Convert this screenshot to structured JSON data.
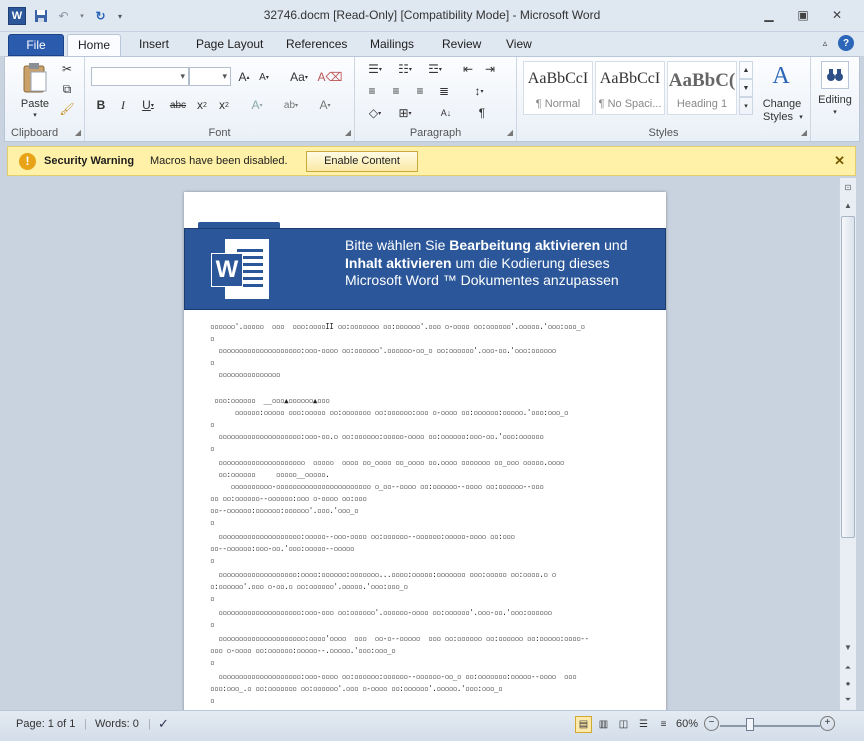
{
  "window": {
    "title": "32746.docm [Read-Only] [Compatibility Mode]  -  Microsoft Word",
    "app_icon": "W"
  },
  "ribbon_tabs": [
    "File",
    "Home",
    "Insert",
    "Page Layout",
    "References",
    "Mailings",
    "Review",
    "View"
  ],
  "groups": {
    "clipboard": {
      "label": "Clipboard",
      "paste": "Paste"
    },
    "font": {
      "label": "Font"
    },
    "paragraph": {
      "label": "Paragraph"
    },
    "styles": {
      "label": "Styles",
      "items": [
        {
          "sample": "AaBbCcI",
          "name": "¶ Normal"
        },
        {
          "sample": "AaBbCcI",
          "name": "¶ No Spaci..."
        },
        {
          "sample": "AaBbC(",
          "name": "Heading 1"
        }
      ],
      "change_styles_line1": "Change",
      "change_styles_line2": "Styles"
    },
    "editing": {
      "label": "Editing"
    }
  },
  "security_bar": {
    "title": "Security Warning",
    "message": "Macros have been disabled.",
    "button": "Enable Content"
  },
  "document": {
    "banner_line1_pre": "Bitte wählen Sie ",
    "banner_line1_bold": "Bearbeitung aktivieren",
    "banner_line1_post": "  und",
    "banner_line2_bold": "Inhalt aktivieren",
    "banner_line2_post": " um die Kodierung dieses",
    "banner_line3": "Microsoft Word ™  Dokumentes anzupassen",
    "logo_letter": "W"
  },
  "statusbar": {
    "page": "Page: 1 of 1",
    "words": "Words: 0",
    "zoom": "60%"
  },
  "colors": {
    "word_blue": "#2b579a",
    "security_bar_bg": "#fff2a8",
    "file_tab": "#2a5bad"
  }
}
